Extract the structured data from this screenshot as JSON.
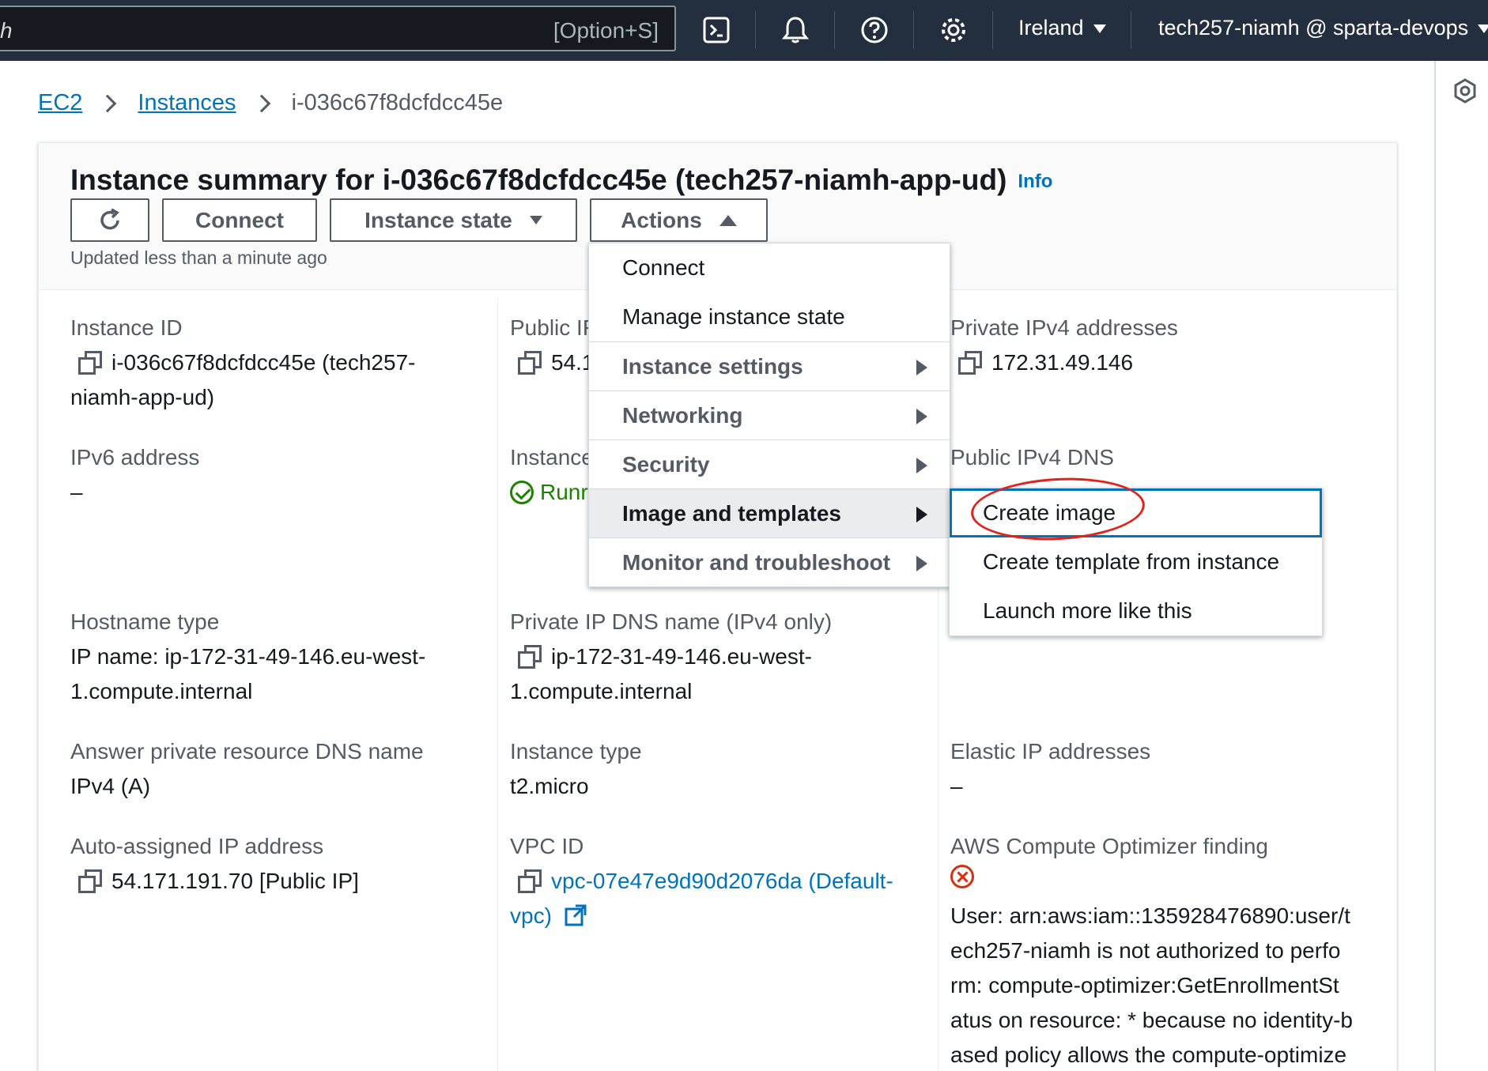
{
  "topnav": {
    "search_text": "h",
    "search_shortcut": "[Option+S]",
    "region": "Ireland",
    "account": "tech257-niamh @ sparta-devops"
  },
  "breadcrumb": {
    "root": "EC2",
    "instances": "Instances",
    "current": "i-036c67f8dcfdcc45e"
  },
  "header": {
    "title": "Instance summary for i-036c67f8dcfdcc45e (tech257-niamh-app-ud)",
    "info": "Info",
    "connect_label": "Connect",
    "instance_state_label": "Instance state",
    "actions_label": "Actions",
    "updated": "Updated less than a minute ago"
  },
  "fields": {
    "instance_id_label": "Instance ID",
    "instance_id_value_1": "i-036c67f8dcfdcc45e (tech257-",
    "instance_id_value_2": "niamh-app-ud)",
    "public_ip_label": "Public IF",
    "public_ip_value": "54.1",
    "private_ipv4_label": "Private IPv4 addresses",
    "private_ipv4_value": "172.31.49.146",
    "ipv6_label": "IPv6 address",
    "ipv6_value": "–",
    "instance_state_label": "Instance",
    "instance_state_value": "Runr",
    "public_dns_label": "Public IPv4 DNS",
    "hostname_type_label": "Hostname type",
    "hostname_type_value_1": "IP name: ip-172-31-49-146.eu-west-",
    "hostname_type_value_2": "1.compute.internal",
    "private_dns_label": "Private IP DNS name (IPv4 only)",
    "private_dns_value_1": "ip-172-31-49-146.eu-west-",
    "private_dns_value_2": "1.compute.internal",
    "answer_dns_label": "Answer private resource DNS name",
    "answer_dns_value": "IPv4 (A)",
    "instance_type_label": "Instance type",
    "instance_type_value": "t2.micro",
    "elastic_ip_label": "Elastic IP addresses",
    "elastic_ip_value": "–",
    "auto_ip_label": "Auto-assigned IP address",
    "auto_ip_value": "54.171.191.70 [Public IP]",
    "vpc_label": "VPC ID",
    "vpc_value_1": "vpc-07e47e9d90d2076da (Default-",
    "vpc_value_2": "vpc)",
    "optimizer_label": "AWS Compute Optimizer finding",
    "optimizer_lines": [
      "User: arn:aws:iam::135928476890:user/t",
      "ech257-niamh is not authorized to perfo",
      "rm: compute-optimizer:GetEnrollmentSt",
      "atus on resource: * because no identity-b",
      "ased policy allows the compute-optimize"
    ]
  },
  "actions_menu": {
    "items": [
      {
        "label": "Connect"
      },
      {
        "label": "Manage instance state"
      },
      {
        "label": "Instance settings"
      },
      {
        "label": "Networking"
      },
      {
        "label": "Security"
      },
      {
        "label": "Image and templates"
      },
      {
        "label": "Monitor and troubleshoot"
      }
    ]
  },
  "image_submenu": {
    "items": [
      {
        "label": "Create image"
      },
      {
        "label": "Create template from instance"
      },
      {
        "label": "Launch more like this"
      }
    ]
  },
  "colors": {
    "nav_bg": "#232f3e",
    "link": "#0073bb",
    "success": "#1d8102",
    "error": "#d13212",
    "annotation": "#e0231d"
  }
}
